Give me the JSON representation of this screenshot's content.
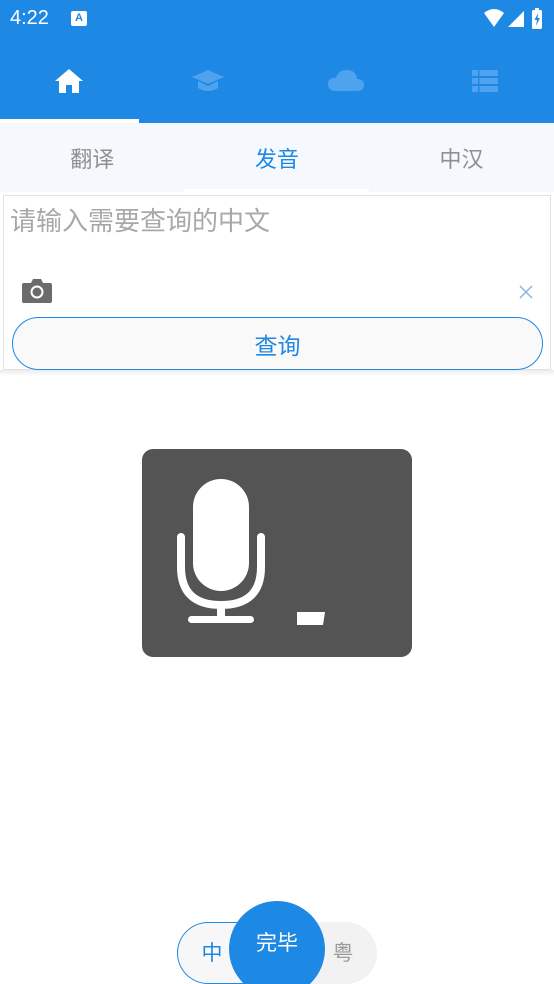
{
  "status_bar": {
    "time": "4:22",
    "app_icon_letter": "A"
  },
  "top_nav": {
    "tabs": [
      {
        "icon": "home-icon",
        "active": true
      },
      {
        "icon": "graduation-cap-icon",
        "active": false
      },
      {
        "icon": "cloud-icon",
        "active": false
      },
      {
        "icon": "list-icon",
        "active": false
      }
    ]
  },
  "sub_tabs": {
    "items": [
      {
        "label": "翻译",
        "active": false
      },
      {
        "label": "发音",
        "active": true
      },
      {
        "label": "中汉",
        "active": false
      }
    ]
  },
  "query": {
    "placeholder": "请输入需要查询的中文",
    "value": "",
    "button_label": "查询"
  },
  "voice": {
    "icon": "microphone-icon"
  },
  "language_toggle": {
    "left_label": "中",
    "done_label": "完毕",
    "right_label": "粤"
  },
  "colors": {
    "accent": "#1E88E5",
    "overlay": "#545454"
  }
}
